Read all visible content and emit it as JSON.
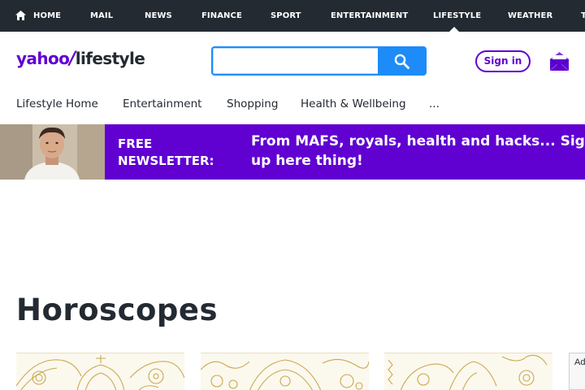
{
  "top_nav": {
    "items": [
      "HOME",
      "MAIL",
      "NEWS",
      "FINANCE",
      "SPORT",
      "ENTERTAINMENT",
      "LIFESTYLE",
      "WEATHER",
      "T"
    ],
    "active": "LIFESTYLE"
  },
  "header": {
    "logo_yahoo": "yahoo",
    "logo_slash": "/",
    "logo_section": "lifestyle",
    "search_placeholder": "",
    "search_value": "",
    "signin_label": "Sign in"
  },
  "sub_nav": {
    "items": [
      "Lifestyle Home",
      "Entertainment",
      "Shopping",
      "Health & Wellbeing",
      "..."
    ]
  },
  "banner": {
    "label_line1": "FREE",
    "label_line2": "NEWSLETTER:",
    "text": "From MAFS, royals, health and hacks... Sign up here thing!"
  },
  "main": {
    "title": "Horoscopes"
  },
  "ad": {
    "label": "Ad"
  },
  "colors": {
    "nav_bg": "#232a31",
    "brand_purple": "#6001d2",
    "search_blue": "#1d8cf8",
    "card_gold": "#c9a94e"
  },
  "icons": [
    "home-icon",
    "search-icon",
    "mail-icon"
  ]
}
